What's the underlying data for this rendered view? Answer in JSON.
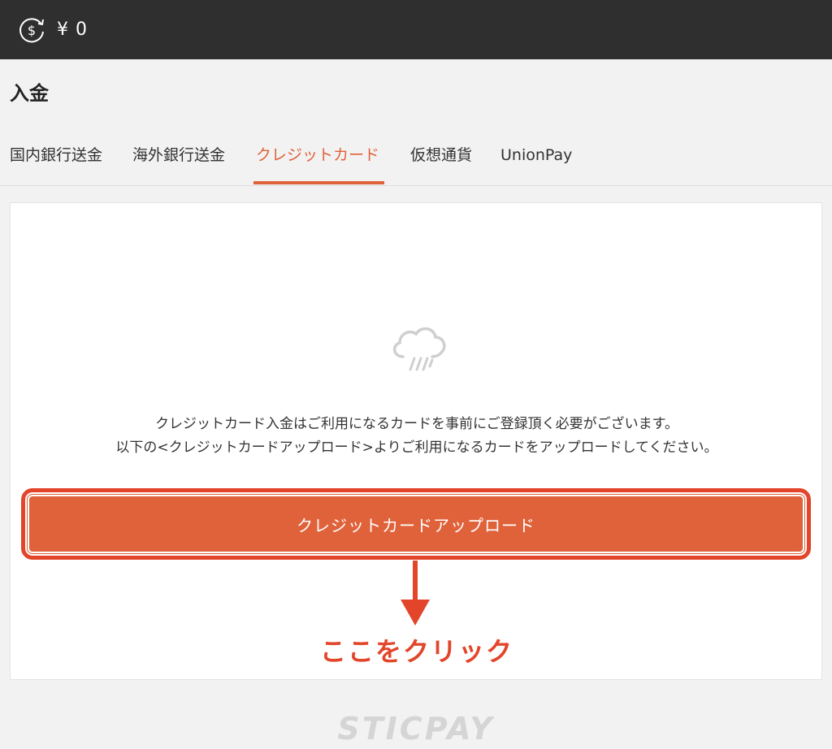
{
  "header": {
    "balance_icon": "currency-refresh-icon",
    "balance": "¥ 0"
  },
  "page": {
    "title": "入金"
  },
  "tabs": [
    {
      "label": "国内銀行送金",
      "active": false
    },
    {
      "label": "海外銀行送金",
      "active": false
    },
    {
      "label": "クレジットカード",
      "active": true
    },
    {
      "label": "仮想通貨",
      "active": false
    },
    {
      "label": "UnionPay",
      "active": false
    }
  ],
  "content": {
    "icon": "cloud-rain-icon",
    "message_line1": "クレジットカード入金はご利用になるカードを事前にご登録頂く必要がございます。",
    "message_line2": "以下の<クレジットカードアップロード>よりご利用になるカードをアップロードしてください。",
    "upload_button_label": "クレジットカードアップロード",
    "annotation": "ここをクリック"
  },
  "footer": {
    "logo_text": "STICPAY"
  },
  "colors": {
    "accent": "#e0623a",
    "annotation": "#e2452a",
    "topbar": "#2f2f2f"
  }
}
